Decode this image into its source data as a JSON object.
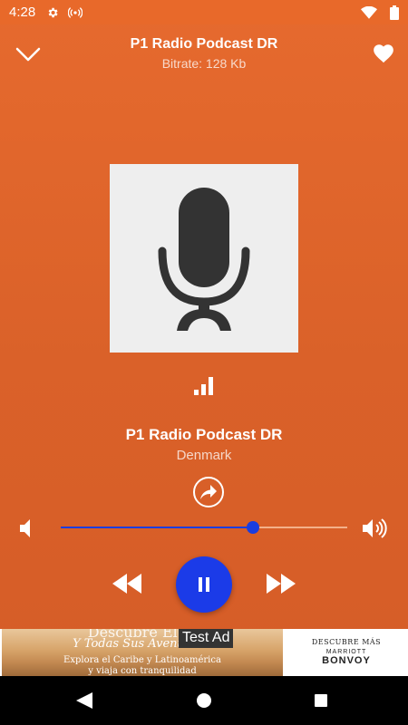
{
  "status_bar": {
    "time": "4:28",
    "icons": [
      "gear-icon",
      "radio-signal-icon",
      "wifi-icon",
      "battery-icon"
    ]
  },
  "header": {
    "title": "P1 Radio Podcast DR",
    "subtitle": "Bitrate: 128 Kb"
  },
  "station": {
    "name": "P1 Radio Podcast DR",
    "country": "Denmark"
  },
  "volume": {
    "level": 0.67
  },
  "player": {
    "state": "playing"
  },
  "ad": {
    "label": "Test Ad",
    "headline": "Descubre El M",
    "subheadline": "Y Todas Sus Aventuras.",
    "body_line1": "Explora el Caribe y Latinoamérica",
    "body_line2": "y viaja con tranquilidad",
    "right_tagline": "DESCUBRE MÁS",
    "right_brand1": "MARRIOTT",
    "right_brand2": "BONVOY"
  },
  "colors": {
    "background": "#D9622A",
    "accent": "#1B3BE8",
    "track": "#F3B089"
  }
}
